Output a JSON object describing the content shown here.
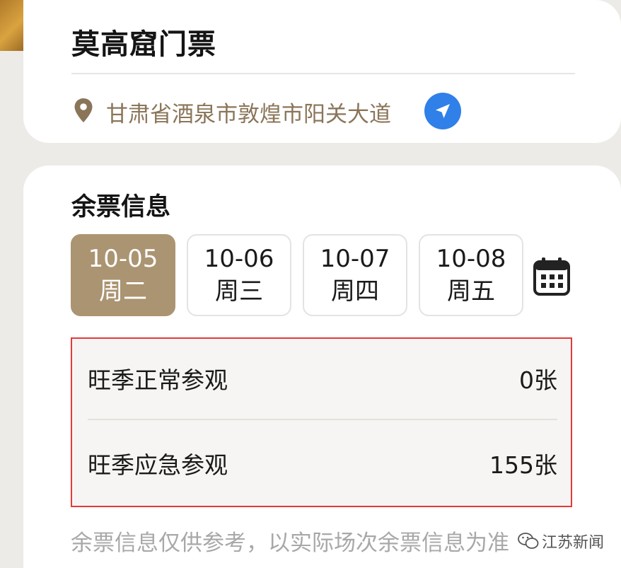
{
  "attraction": {
    "name": "莫高窟门票",
    "address": "甘肃省酒泉市敦煌市阳关大道"
  },
  "tickets": {
    "section_title": "余票信息",
    "dates": [
      {
        "date": "10-05",
        "weekday": "周二",
        "selected": true
      },
      {
        "date": "10-06",
        "weekday": "周三",
        "selected": false
      },
      {
        "date": "10-07",
        "weekday": "周四",
        "selected": false
      },
      {
        "date": "10-08",
        "weekday": "周五",
        "selected": false
      }
    ],
    "types": [
      {
        "label": "旺季正常参观",
        "count": "0张"
      },
      {
        "label": "旺季应急参观",
        "count": "155张"
      }
    ],
    "note": "余票信息仅供参考，以实际场次余票信息为准"
  },
  "watermark": {
    "text": "江苏新闻"
  },
  "colors": {
    "accent": "#ab9472",
    "nav_button": "#2f80e8",
    "highlight_border": "#e33a3a",
    "address_text": "#8a7559"
  },
  "icons": {
    "location": "map-pin-icon",
    "navigate": "navigation-arrow-icon",
    "calendar": "calendar-icon",
    "watermark": "wechat-icon"
  }
}
